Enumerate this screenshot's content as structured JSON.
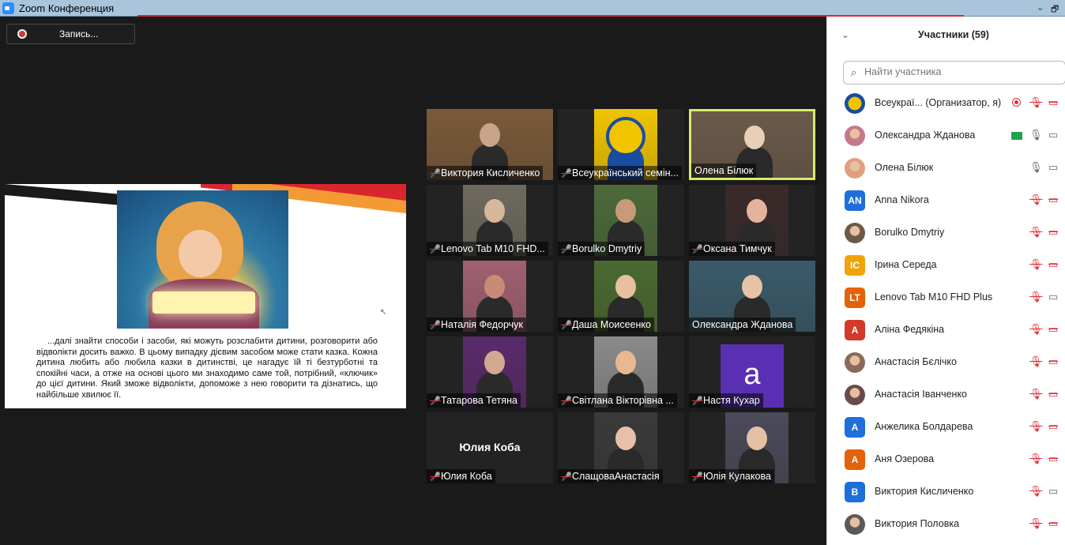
{
  "window": {
    "title": "Zoom Конференция",
    "ctrl_min": "⌄",
    "ctrl_restore": "🗗"
  },
  "recording": {
    "label": "Запись..."
  },
  "slide": {
    "text": "...далі знайти способи і засоби, які можуть розслабити дитини, розговорити або відволікти досить важко. В цьому випадку дієвим засобом може стати казка. Кожна дитина любить або любила казки в дитинстві, це нагадує їй ті безтурботні та спокійні часи, а отже на основі цього ми знаходимо саме той, потрібний, «ключик» до цієї дитини. Який зможе відволікти, допоможе з нею говорити та дізнатись, що найбільше хвилює її."
  },
  "gallery": [
    {
      "name": "Виктория Кисличенко",
      "muted": true
    },
    {
      "name": "Всеукраїнський семін...",
      "muted": true
    },
    {
      "name": "Олена Білюк",
      "muted": false,
      "active": true
    },
    {
      "name": "Lenovo Tab M10 FHD...",
      "muted": true
    },
    {
      "name": "Borulko Dmytriy",
      "muted": true
    },
    {
      "name": "Оксана Тимчук",
      "muted": true
    },
    {
      "name": "Наталія Федорчук",
      "muted": true
    },
    {
      "name": "Даша Моисеенко",
      "muted": true
    },
    {
      "name": "Олександра Жданова",
      "muted": false
    },
    {
      "name": "Татарова Тетяна",
      "muted": true
    },
    {
      "name": "Світлана Вікторівна ...",
      "muted": true
    },
    {
      "name": "Настя Кухар",
      "muted": true,
      "letter": "a"
    },
    {
      "name": "Юлия Коба",
      "muted": true,
      "bigname": "Юлия Коба"
    },
    {
      "name": "СлащоваАнастасія",
      "muted": true
    },
    {
      "name": "Юлія Кулакова",
      "muted": true
    }
  ],
  "panel": {
    "collapse_icon": "⌄",
    "title": "Участники (59)",
    "search_placeholder": "Найти участника",
    "participants": [
      {
        "name": "Всеукраї...  (Организатор, я)",
        "avatar": "logo",
        "recording": true,
        "mic": "muted",
        "cam": "off"
      },
      {
        "name": "Олександра Жданова",
        "avatar": "photo",
        "sharing": true,
        "mic": "on",
        "cam": "on"
      },
      {
        "name": "Олена Білюк",
        "avatar": "photo",
        "mic": "on",
        "cam": "on"
      },
      {
        "name": "Anna Nikora",
        "avatar": "AN",
        "color": "#1e6fd9",
        "mic": "muted",
        "cam": "off"
      },
      {
        "name": "Borulko Dmytriy",
        "avatar": "photo",
        "mic": "muted",
        "cam": "off"
      },
      {
        "name": "Ірина Середа",
        "avatar": "IC",
        "color": "#f0a30a",
        "mic": "muted",
        "cam": "off"
      },
      {
        "name": "Lenovo Tab M10 FHD Plus",
        "avatar": "LT",
        "color": "#e3620a",
        "mic": "muted",
        "cam": "on"
      },
      {
        "name": "Аліна Федякіна",
        "avatar": "А",
        "color": "#d23a2a",
        "mic": "muted",
        "cam": "off"
      },
      {
        "name": "Анастасія Бєлічко",
        "avatar": "photo",
        "mic": "muted",
        "cam": "off"
      },
      {
        "name": "Анастасія Іванченко",
        "avatar": "photo",
        "mic": "muted",
        "cam": "off"
      },
      {
        "name": "Анжелика Болдарева",
        "avatar": "А",
        "color": "#1e6fd9",
        "mic": "muted",
        "cam": "off"
      },
      {
        "name": "Аня Озерова",
        "avatar": "А",
        "color": "#e3620a",
        "mic": "muted",
        "cam": "off"
      },
      {
        "name": "Виктория Кисличенко",
        "avatar": "В",
        "color": "#1e6fd9",
        "mic": "muted",
        "cam": "on"
      },
      {
        "name": "Виктория Половка",
        "avatar": "photo",
        "mic": "muted",
        "cam": "off"
      }
    ]
  }
}
